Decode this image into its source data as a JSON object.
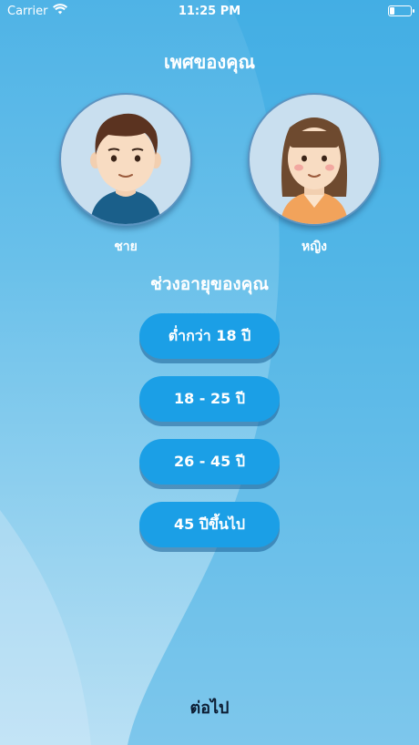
{
  "status_bar": {
    "carrier": "Carrier",
    "time": "11:25 PM",
    "wifi_icon": "wifi-icon",
    "battery_icon": "battery-icon"
  },
  "gender_section": {
    "title": "เพศของคุณ",
    "options": [
      {
        "label": "ชาย",
        "icon": "male-avatar-icon"
      },
      {
        "label": "หญิง",
        "icon": "female-avatar-icon"
      }
    ]
  },
  "age_section": {
    "title": "ช่วงอายุของคุณ",
    "options": [
      {
        "label": "ต่ำกว่า 18 ปี"
      },
      {
        "label": "18 - 25 ปี"
      },
      {
        "label": "26 - 45 ปี"
      },
      {
        "label": "45 ปีขึ้นไป"
      }
    ]
  },
  "footer": {
    "next_label": "ต่อไป"
  },
  "colors": {
    "background_top": "#4fb3e6",
    "background_bottom": "#b9e0f4",
    "button": "#1b9fe6",
    "avatar_circle": "#c9dfef",
    "next_text": "#0c1d33"
  }
}
